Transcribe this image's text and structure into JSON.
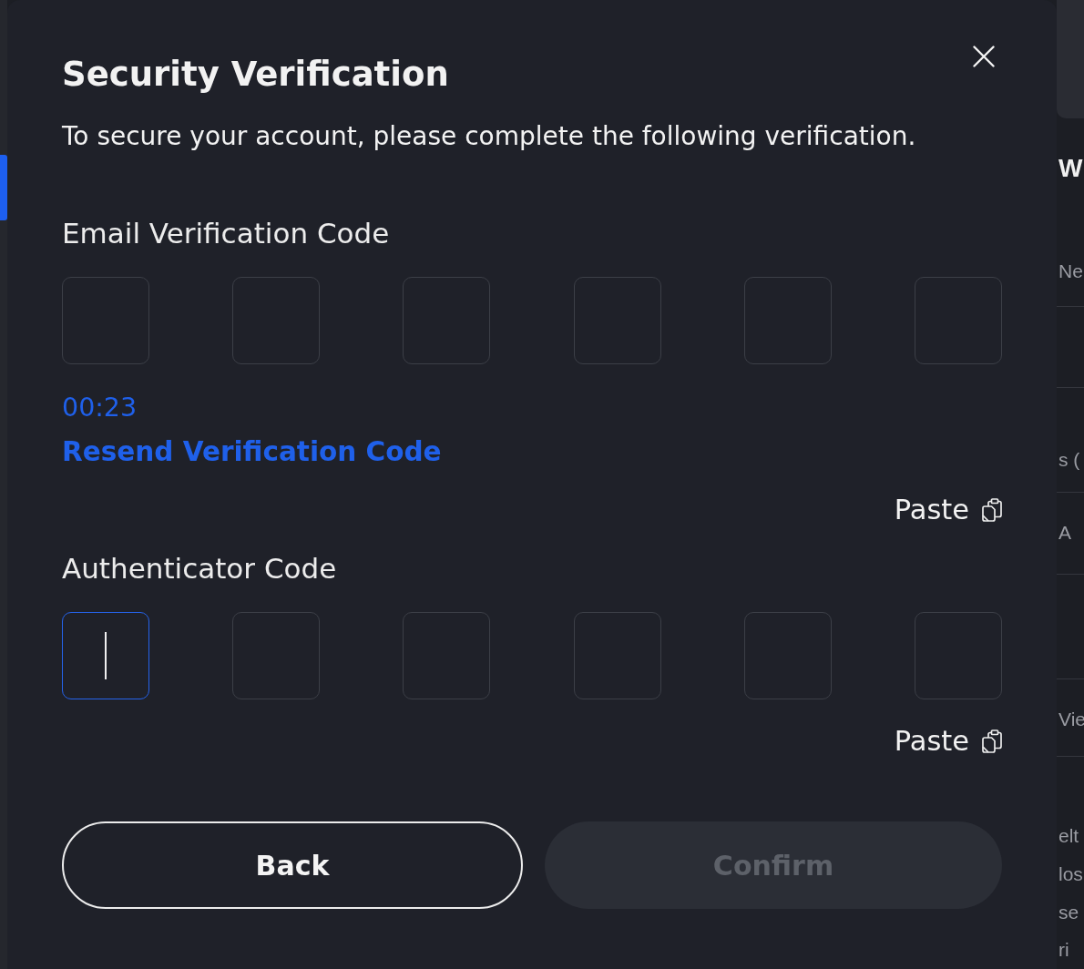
{
  "backdrop": {
    "fragments": [
      {
        "kind": "heading",
        "text": "W"
      },
      {
        "kind": "text",
        "text": "Ne"
      },
      {
        "kind": "text",
        "text": "s ("
      },
      {
        "kind": "text",
        "text": "A"
      },
      {
        "kind": "text",
        "text": "Vie"
      },
      {
        "kind": "text",
        "text": "elt"
      },
      {
        "kind": "text",
        "text": "los"
      },
      {
        "kind": "text",
        "text": "se"
      },
      {
        "kind": "text",
        "text": "ri"
      }
    ]
  },
  "dialog": {
    "title": "Security Verification",
    "subtitle": "To secure your account, please complete the following verification.",
    "sections": [
      {
        "label": "Email Verification Code",
        "boxes": [
          {
            "focused": false
          },
          {
            "focused": false
          },
          {
            "focused": false
          },
          {
            "focused": false
          },
          {
            "focused": false
          },
          {
            "focused": false
          }
        ],
        "timer": "00:23",
        "resend_link": "Resend Verification Code",
        "paste_button": "Paste"
      },
      {
        "label": "Authenticator Code",
        "boxes": [
          {
            "focused": true
          },
          {
            "focused": false
          },
          {
            "focused": false
          },
          {
            "focused": false
          },
          {
            "focused": false
          },
          {
            "focused": false
          }
        ],
        "paste_button": "Paste"
      }
    ],
    "buttons": [
      {
        "label": "Back",
        "kind": "outline",
        "disabled": false
      },
      {
        "label": "Confirm",
        "kind": "filled",
        "disabled": true
      }
    ]
  }
}
